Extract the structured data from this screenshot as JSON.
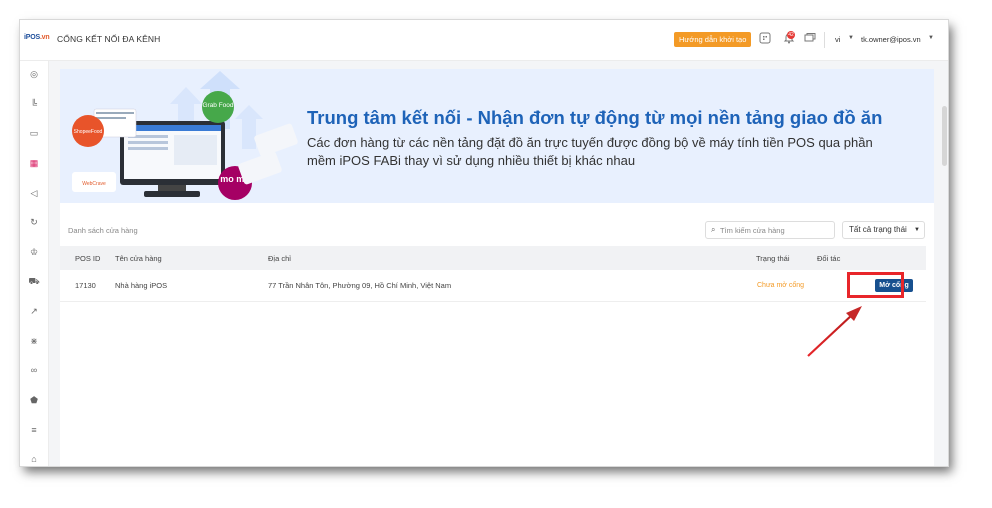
{
  "app": {
    "logo": "iPOS",
    "logo_ext": ".vn",
    "page_title": "CỔNG KẾT NỐI ĐA KÊNH"
  },
  "topbar": {
    "guide_button": "Hướng dẫn khởi tạo",
    "notification_count": "42",
    "language": "vi",
    "user_email": "tk.owner@ipos.vn"
  },
  "banner": {
    "title": "Trung tâm kết nối - Nhận đơn tự động từ mọi nền tảng giao đồ ăn",
    "description": "Các đơn hàng từ các nền tảng đặt đồ ăn trực tuyến được đồng bộ về máy tính tiền POS qua phần mềm iPOS FABi thay vì sử dụng nhiều thiết bị khác nhau",
    "brands": {
      "grab": "Grab Food",
      "shopee": "ShopeeFood",
      "momo": "mo mo",
      "webcrave": "WebCrave"
    }
  },
  "stores": {
    "section_label": "Danh sách cửa hàng",
    "search_placeholder": "Tìm kiếm cửa hàng",
    "status_filter": "Tất cả trạng thái",
    "columns": {
      "pos_id": "POS ID",
      "name": "Tên cửa hàng",
      "address": "Địa chỉ",
      "status": "Trạng thái",
      "partner": "Đối tác"
    },
    "rows": [
      {
        "pos_id": "17130",
        "name": "Nhà hàng iPOS",
        "address": "77 Trần Nhân Tôn, Phường 09, Hồ Chí Minh, Việt Nam",
        "status": "Chưa mở cổng",
        "action": "Mở cổng"
      }
    ]
  },
  "colors": {
    "accent_blue": "#1e63b8",
    "orange": "#f39a26",
    "highlight_red": "#e8262a",
    "button_navy": "#17508f"
  },
  "icons": {
    "sidebar": [
      "dashboard-icon",
      "chart-icon",
      "chat-icon",
      "channels-icon",
      "megaphone-icon",
      "sync-icon",
      "crown-icon",
      "delivery-icon",
      "trend-icon",
      "share-icon",
      "link-icon",
      "shield-icon",
      "database-icon",
      "tag-icon"
    ]
  }
}
